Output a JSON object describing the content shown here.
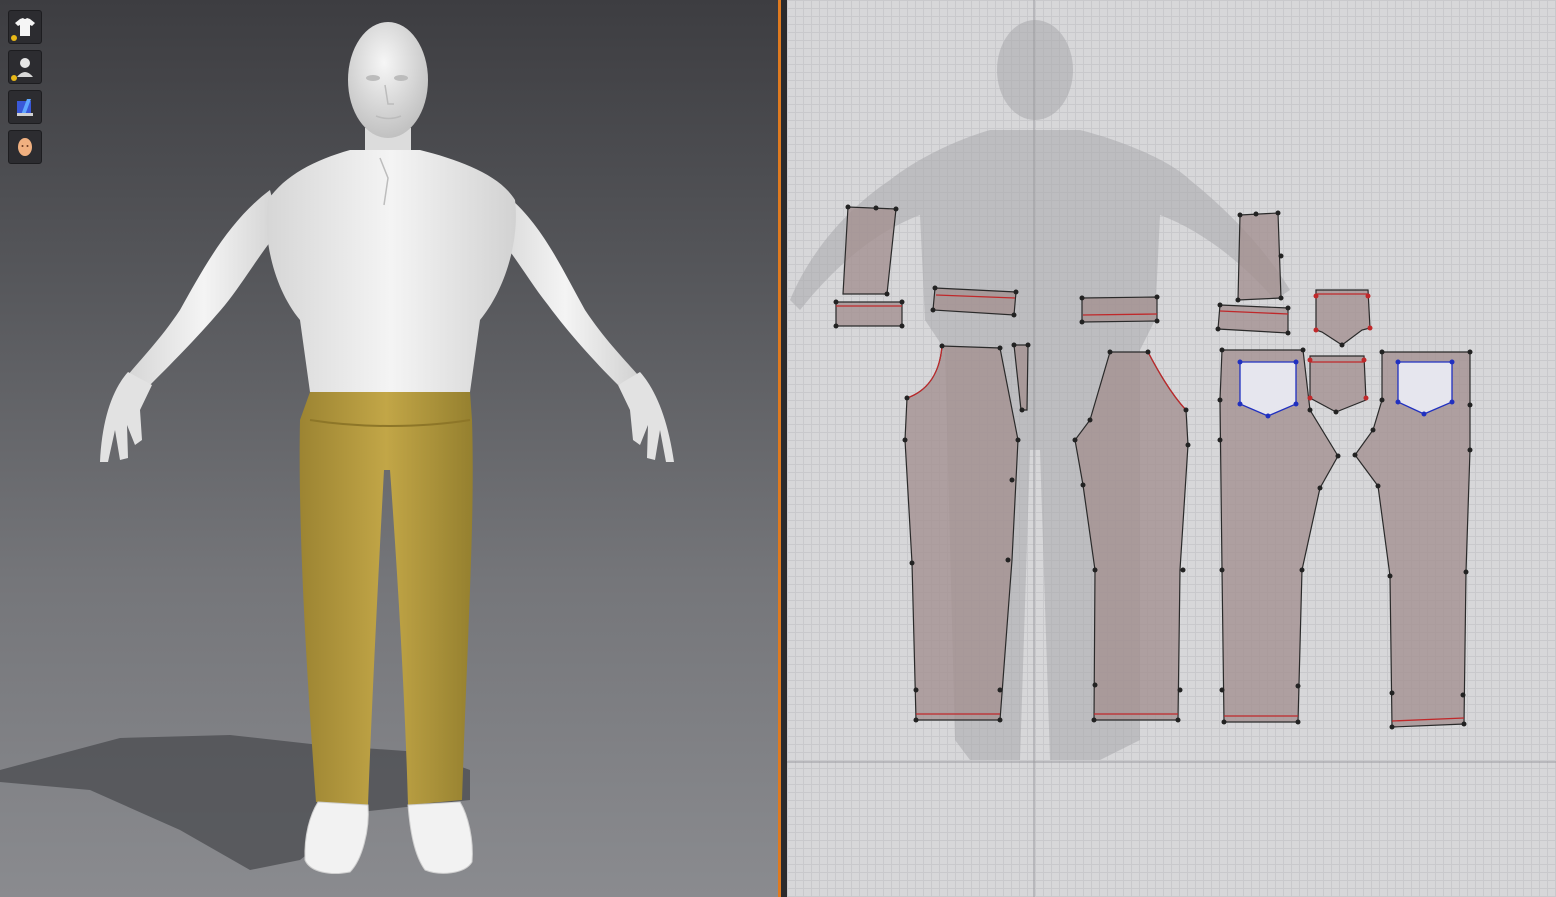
{
  "window": {
    "panes": [
      "3d-garment-view",
      "2d-pattern-view"
    ]
  },
  "toolbar": {
    "items": [
      {
        "icon": "garment-tshirt-icon",
        "active": true
      },
      {
        "icon": "avatar-pose-icon",
        "active": true
      },
      {
        "icon": "texture-material-icon",
        "active": false
      },
      {
        "icon": "avatar-head-icon",
        "active": false
      }
    ]
  },
  "scene3d": {
    "shirt_color": "#ededed",
    "pants_color": "#b49a3f",
    "skin_color": "#e4e4e4",
    "shoe_color": "#f2f2f2"
  },
  "pattern2d": {
    "piece_fill": "#a38f8f",
    "seam_color": "#c0282a",
    "pocket_outline_color": "#2030c0",
    "point_color": "#222222",
    "pieces": [
      "front-yoke-panel",
      "waistband-left-a",
      "waistband-left-b",
      "fly-strip",
      "front-left-leg",
      "waistband-center",
      "back-left-leg",
      "back-yoke-panel",
      "waistband-right",
      "back-pocket-top",
      "back-pocket-bottom",
      "front-right-leg",
      "back-right-leg"
    ]
  },
  "colors": {
    "splitter_accent": "#e07a1f"
  }
}
